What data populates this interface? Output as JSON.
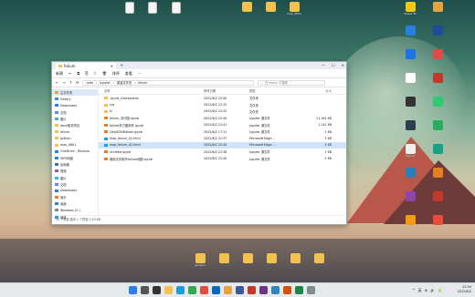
{
  "desktop": {
    "top_icons": [
      {
        "label": "",
        "kind": "doc"
      },
      {
        "label": "",
        "kind": "doc"
      },
      {
        "label": "",
        "kind": "doc"
      },
      {
        "label": "",
        "kind": "folder"
      },
      {
        "label": "",
        "kind": "folder"
      },
      {
        "label": "map_0601",
        "kind": "folder"
      }
    ],
    "right_icons": [
      {
        "label": "Power BI",
        "color": "#f2c811"
      },
      {
        "label": "",
        "color": "#e6a23c"
      },
      {
        "label": "",
        "color": "#2a7de1"
      },
      {
        "label": "",
        "color": "#1e4c9a"
      },
      {
        "label": "",
        "color": "#1a73e8"
      },
      {
        "label": "",
        "color": "#e24a4a"
      },
      {
        "label": "",
        "color": "#ffffff"
      },
      {
        "label": "",
        "color": "#c0392b"
      },
      {
        "label": "",
        "color": "#333333"
      },
      {
        "label": "",
        "color": "#2ecc71"
      },
      {
        "label": "",
        "color": "#2c3e50"
      },
      {
        "label": "",
        "color": "#27ae60"
      },
      {
        "label": "Typora",
        "color": "#f0f0f0"
      },
      {
        "label": "",
        "color": "#16a085"
      },
      {
        "label": "",
        "color": "#2980b9"
      },
      {
        "label": "",
        "color": "#e67e22"
      },
      {
        "label": "",
        "color": "#8e44ad"
      },
      {
        "label": "",
        "color": "#c0392b"
      },
      {
        "label": "",
        "color": "#f39c12"
      },
      {
        "label": "",
        "color": "#e74c3c"
      }
    ],
    "bottom_icons": [
      {
        "label": "geojson"
      },
      {
        "label": ""
      },
      {
        "label": ""
      },
      {
        "label": ""
      },
      {
        "label": ""
      },
      {
        "label": ""
      }
    ]
  },
  "explorer": {
    "tab_title": "folium",
    "new_tab": "+",
    "window_controls": {
      "minimize": "—",
      "maximize": "☐",
      "close": "✕"
    },
    "commands": [
      "新建",
      "✂",
      "⧉",
      "⎘",
      "⇪",
      "🗑",
      "排序",
      "查看",
      "···"
    ],
    "nav": {
      "back": "←",
      "forward": "→",
      "up": "↑",
      "refresh": "⟳"
    },
    "breadcrumb": [
      "code",
      "Jupyter",
      "新建文件夹",
      "folium"
    ],
    "search_placeholder": "在 folium 中搜索",
    "columns": {
      "name": "名称",
      "date": "修改日期",
      "type": "类型",
      "size": "大小"
    },
    "sidebar": [
      {
        "label": "主文件夹",
        "icon": "home",
        "selected": true
      },
      {
        "label": "Gallery",
        "icon": "gallery"
      },
      {
        "label": "Downloads",
        "icon": "download"
      },
      {
        "label": "文档",
        "icon": "doc"
      },
      {
        "label": "图片",
        "icon": "pic"
      },
      {
        "label": "dash相关项目",
        "icon": "folder"
      },
      {
        "label": "folium",
        "icon": "folder"
      },
      {
        "label": "python",
        "icon": "folder"
      },
      {
        "label": "map_0601",
        "icon": "folder"
      },
      {
        "label": "OneDrive - Persona",
        "icon": "cloud"
      },
      {
        "label": "WPS网盘",
        "icon": "cloud"
      },
      {
        "label": "此电脑",
        "icon": "pc"
      },
      {
        "label": "视频",
        "icon": "video"
      },
      {
        "label": "图片",
        "icon": "pic"
      },
      {
        "label": "文档",
        "icon": "doc"
      },
      {
        "label": "Downloads",
        "icon": "download"
      },
      {
        "label": "音乐",
        "icon": "music"
      },
      {
        "label": "桌面",
        "icon": "desk"
      },
      {
        "label": "Windows (C:)",
        "icon": "drive"
      },
      {
        "label": "网络",
        "icon": "net"
      }
    ],
    "files": [
      {
        "name": ".ipynb_checkpoints",
        "date": "2022/6/2 22:50",
        "type": "文件夹",
        "size": "",
        "icon": "folder"
      },
      {
        "name": "css",
        "date": "2022/6/2 22:32",
        "type": "文件夹",
        "size": "",
        "icon": "folder"
      },
      {
        "name": "js",
        "date": "2022/6/2 22:32",
        "type": "文件夹",
        "size": "",
        "icon": "folder"
      },
      {
        "name": "folium_流行图.ipynb",
        "date": "2022/6/2 22:40",
        "type": "Jupyter 源文件",
        "size": "11,161 KB",
        "icon": "nb"
      },
      {
        "name": "folium热力图制作.ipynb",
        "date": "2022/6/2 22:41",
        "type": "Jupyter 源文件",
        "size": "1,142 KB",
        "icon": "nb"
      },
      {
        "name": "GeoJSONMarker.ipynb",
        "date": "2022/6/2 17:11",
        "type": "Jupyter 源文件",
        "size": "1 KB",
        "icon": "nb"
      },
      {
        "name": "map_folium_01.html",
        "date": "2022/6/2 22:37",
        "type": "Microsoft Edge ...",
        "size": "3 KB",
        "icon": "edge"
      },
      {
        "name": "map_folium_02.html",
        "date": "2022/6/2 22:44",
        "type": "Microsoft Edge ...",
        "size": "3 KB",
        "icon": "edge",
        "selected": true
      },
      {
        "name": "Untitled.ipynb",
        "date": "2022/6/2 22:38",
        "type": "Jupyter 源文件",
        "size": "1 KB",
        "icon": "nb"
      },
      {
        "name": "使用文件制作folium地图.ipynb",
        "date": "2022/6/2 22:40",
        "type": "Jupyter 源文件",
        "size": "3 KB",
        "icon": "nb"
      }
    ],
    "status": "10 个项目   选中 1 个项目  2.53 KB"
  },
  "taskbar": {
    "apps": [
      {
        "name": "windows-start",
        "color": "#2b7de9"
      },
      {
        "name": "search",
        "color": "#555555"
      },
      {
        "name": "task-view",
        "color": "#333333"
      },
      {
        "name": "file-explorer",
        "color": "#f2c14e"
      },
      {
        "name": "edge",
        "color": "#1a9fd9"
      },
      {
        "name": "chrome",
        "color": "#34a853"
      },
      {
        "name": "app",
        "color": "#e04f3c"
      },
      {
        "name": "app2",
        "color": "#0a66c2"
      },
      {
        "name": "app3",
        "color": "#e7a33e"
      },
      {
        "name": "app4",
        "color": "#3b5998"
      },
      {
        "name": "app5",
        "color": "#c0392b"
      },
      {
        "name": "app6",
        "color": "#6c3483"
      },
      {
        "name": "app7",
        "color": "#2e86c1"
      },
      {
        "name": "app8",
        "color": "#d35400"
      },
      {
        "name": "app9",
        "color": "#1e8449"
      },
      {
        "name": "app10",
        "color": "#7f8c8d"
      }
    ],
    "tray": [
      "^",
      "英",
      "⊕",
      "🔊",
      "🔋"
    ],
    "time": "22:54",
    "date": "2022/6/2"
  }
}
